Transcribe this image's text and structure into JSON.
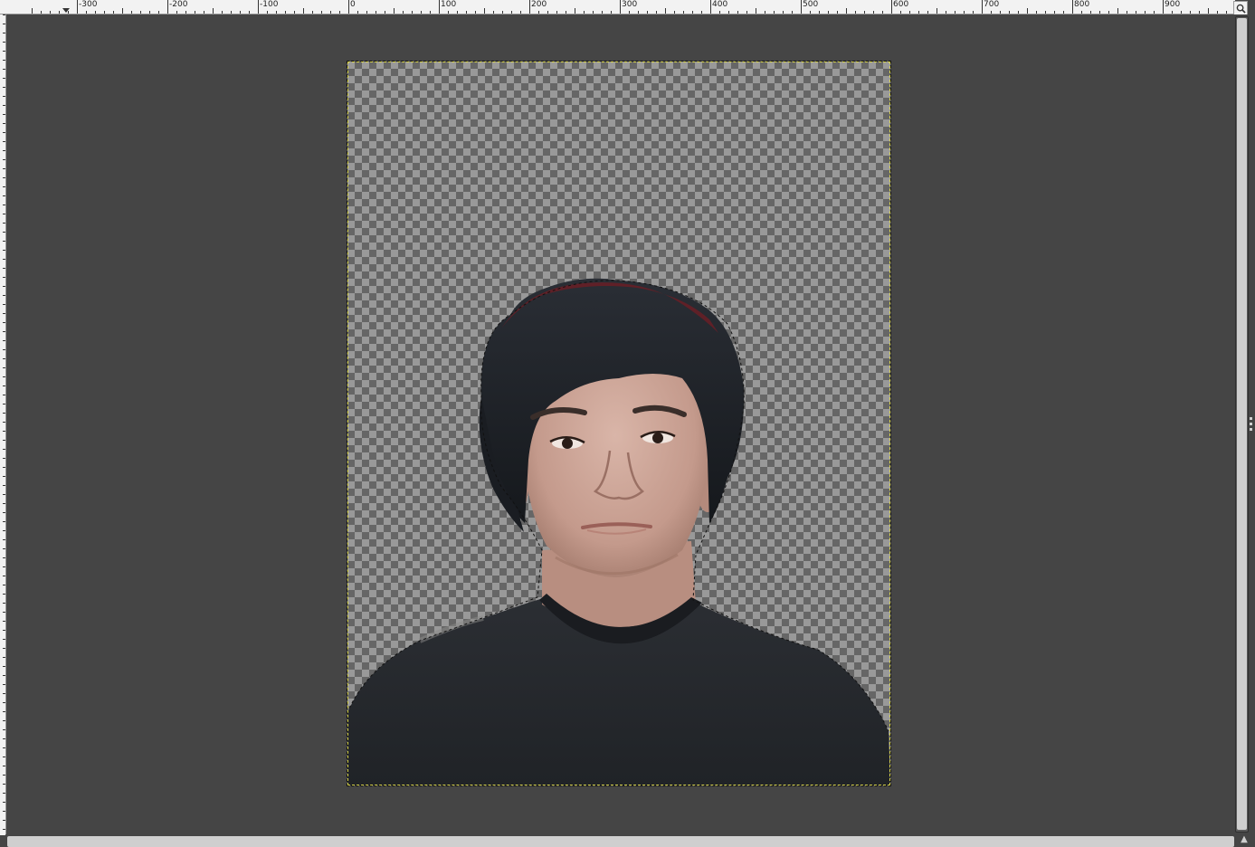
{
  "window": {
    "app": "GIMP",
    "view": "image-canvas"
  },
  "ruler_top": {
    "labels": [
      "-300",
      "-200",
      "-100",
      "0",
      "100",
      "200",
      "300",
      "400",
      "500",
      "600",
      "700",
      "800",
      "900"
    ]
  },
  "canvas": {
    "content": "portrait-cutout",
    "transparent_background": true,
    "selection_active": true
  },
  "icons": {
    "zoom": "zoom-icon",
    "navigate": "navigate-icon"
  },
  "colors": {
    "workspace": "#454545",
    "checker_light": "#999999",
    "checker_dark": "#666666",
    "layer_boundary": "#d8d44a",
    "ruler": "#f2f2f2"
  }
}
